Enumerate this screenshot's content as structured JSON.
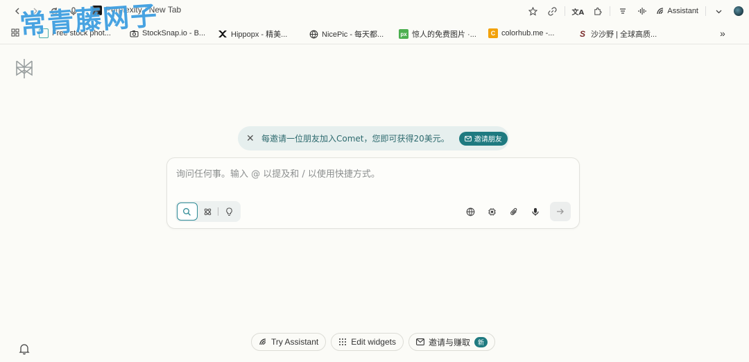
{
  "watermark": "常青藤网子",
  "browser": {
    "tab_title": "Perplexity / New Tab",
    "assistant_label": "Assistant"
  },
  "bookmarks": [
    {
      "label": "Free stock phot...",
      "icon": "image-icon"
    },
    {
      "label": "StockSnap.io - B...",
      "icon": "camera-icon"
    },
    {
      "label": "Hippopx - 精美...",
      "icon": "hippo-icon"
    },
    {
      "label": "NicePic - 每天都...",
      "icon": "globe-icon"
    },
    {
      "label": "惊人的免费图片 ·...",
      "icon": "px-icon"
    },
    {
      "label": "colorhub.me -...",
      "icon": "c-icon"
    },
    {
      "label": "沙沙野 | 全球高质...",
      "icon": "s-icon"
    }
  ],
  "referral": {
    "message": "每邀请一位朋友加入Comet，您即可获得20美元。",
    "button": "邀请朋友"
  },
  "composer": {
    "placeholder": "询问任何事。输入 @ 以提及和 / 以使用快捷方式。"
  },
  "bottom": {
    "try_assistant": "Try Assistant",
    "edit_widgets": "Edit widgets",
    "invite_earn": "邀请与赚取",
    "new_badge": "新"
  },
  "colors": {
    "accent": "#1f7a80",
    "background": "#fbfbf7",
    "banner": "#e6efee"
  }
}
